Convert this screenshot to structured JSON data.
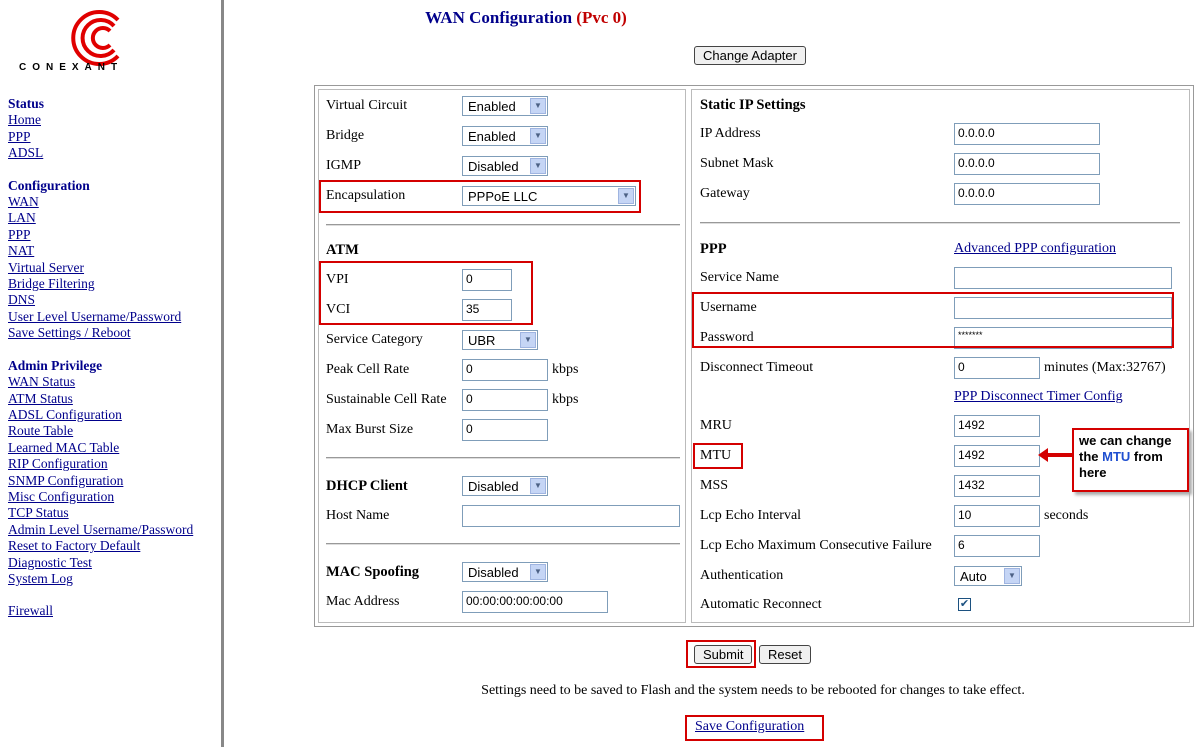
{
  "logo": {
    "word": "CONEXANT"
  },
  "nav": {
    "status_heading": "Status",
    "status": [
      "Home",
      "PPP",
      "ADSL"
    ],
    "config_heading": "Configuration",
    "config": [
      "WAN",
      "LAN",
      "PPP",
      "NAT",
      "Virtual Server",
      "Bridge Filtering",
      "DNS",
      "User Level Username/Password",
      "Save Settings / Reboot"
    ],
    "admin_heading": "Admin Privilege",
    "admin": [
      "WAN Status",
      "ATM Status",
      "ADSL Configuration",
      "Route Table",
      "Learned MAC Table",
      "RIP Configuration",
      "SNMP Configuration",
      "Misc Configuration",
      "TCP Status",
      "Admin Level Username/Password",
      "Reset to Factory Default",
      "Diagnostic Test",
      "System Log"
    ],
    "firewall": "Firewall"
  },
  "page": {
    "title": "WAN Configuration",
    "pvc": "(Pvc 0)",
    "change_adapter": "Change Adapter"
  },
  "left": {
    "virtual_circuit": {
      "label": "Virtual Circuit",
      "value": "Enabled"
    },
    "bridge": {
      "label": "Bridge",
      "value": "Enabled"
    },
    "igmp": {
      "label": "IGMP",
      "value": "Disabled"
    },
    "encapsulation": {
      "label": "Encapsulation",
      "value": "PPPoE LLC"
    },
    "atm_heading": "ATM",
    "vpi": {
      "label": "VPI",
      "value": "0"
    },
    "vci": {
      "label": "VCI",
      "value": "35"
    },
    "service_category": {
      "label": "Service Category",
      "value": "UBR"
    },
    "peak_cell_rate": {
      "label": "Peak Cell Rate",
      "value": "0",
      "unit": "kbps"
    },
    "sustainable_cell_rate": {
      "label": "Sustainable Cell Rate",
      "value": "0",
      "unit": "kbps"
    },
    "max_burst_size": {
      "label": "Max Burst Size",
      "value": "0"
    },
    "dhcp_heading": "DHCP Client",
    "dhcp_value": "Disabled",
    "host_name": {
      "label": "Host Name",
      "value": ""
    },
    "mac_heading": "MAC Spoofing",
    "mac_value": "Disabled",
    "mac_address": {
      "label": "Mac Address",
      "value": "00:00:00:00:00:00"
    }
  },
  "right": {
    "static_heading": "Static IP Settings",
    "ip_address": {
      "label": "IP Address",
      "value": "0.0.0.0"
    },
    "subnet_mask": {
      "label": "Subnet Mask",
      "value": "0.0.0.0"
    },
    "gateway": {
      "label": "Gateway",
      "value": "0.0.0.0"
    },
    "ppp_heading": "PPP",
    "advanced_link": "Advanced PPP configuration",
    "service_name": {
      "label": "Service Name",
      "value": ""
    },
    "username": {
      "label": "Username",
      "value": ""
    },
    "password": {
      "label": "Password",
      "value": "*******"
    },
    "disconnect_timeout": {
      "label": "Disconnect Timeout",
      "value": "0",
      "unit": "minutes (Max:32767)"
    },
    "timer_link": "PPP Disconnect Timer Config",
    "mru": {
      "label": "MRU",
      "value": "1492"
    },
    "mtu": {
      "label": "MTU",
      "value": "1492"
    },
    "mss": {
      "label": "MSS",
      "value": "1432"
    },
    "lcp_interval": {
      "label": "Lcp Echo Interval",
      "value": "10",
      "unit": "seconds"
    },
    "lcp_failure": {
      "label": "Lcp Echo Maximum Consecutive Failure",
      "value": "6"
    },
    "authentication": {
      "label": "Authentication",
      "value": "Auto"
    },
    "auto_reconnect": {
      "label": "Automatic Reconnect",
      "checked": "✔"
    }
  },
  "callout": {
    "line1": "we can change",
    "the": "the",
    "mtu": "MTU",
    "from": "from",
    "line3": "here"
  },
  "footer": {
    "submit": "Submit",
    "reset": "Reset",
    "note": "Settings need to be saved to Flash and the system needs to be rebooted for changes to take effect.",
    "save_link": "Save Configuration"
  },
  "colors": {
    "link": "#00008b",
    "annotation": "#d40000",
    "pvc": "#c00000"
  }
}
